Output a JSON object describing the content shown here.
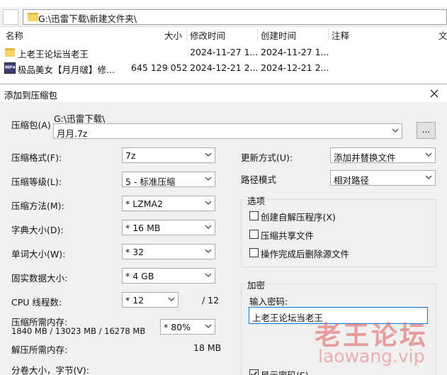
{
  "explorer": {
    "path": "G:\\迅雷下载\\新建文件夹\\",
    "columns": {
      "name": "名称",
      "size": "大小",
      "modified": "修改时间",
      "created": "创建时间",
      "comment": "注释",
      "overflow": "文"
    },
    "files": [
      {
        "name": "上老王论坛当老王",
        "size": "",
        "modified": "2024-11-27 1...",
        "created": "2024-11-27 1...",
        "icon": "folder-icon"
      },
      {
        "name": "极品美女【月月啵】修...",
        "size": "645 129 052",
        "modified": "2024-12-21 2...",
        "created": "2024-12-21 2...",
        "icon": "video-file-icon"
      }
    ]
  },
  "dialog": {
    "title": "添加到压缩包",
    "archive": {
      "label": "压缩包(A)",
      "folder": "G:\\迅雷下载\\",
      "value": "月月.7z",
      "browse": "..."
    },
    "format": {
      "label": "压缩格式(F):",
      "value": "7z"
    },
    "level": {
      "label": "压缩等级(L):",
      "value": "5 - 标准压缩"
    },
    "method": {
      "label": "压缩方法(M):",
      "value": "* LZMA2"
    },
    "dict": {
      "label": "字典大小(D):",
      "value": "* 16 MB"
    },
    "word": {
      "label": "单词大小(W):",
      "value": "* 32"
    },
    "solid": {
      "label": "固实数据大小:",
      "value": "* 4 GB"
    },
    "threads": {
      "label": "CPU 线程数:",
      "value": "* 12",
      "max": "/ 12"
    },
    "mem_compress": {
      "label": "压缩所需内存:",
      "detail": "1840 MB / 13023 MB / 16278 MB",
      "value": "* 80%"
    },
    "mem_decompress": {
      "label": "解压所需内存:",
      "value": "18 MB"
    },
    "split": {
      "label": "分卷大小，字节(V):"
    },
    "update": {
      "label": "更新方式(U):",
      "value": "添加并替换文件"
    },
    "path_mode": {
      "label": "路径模式",
      "value": "相对路径"
    },
    "options": {
      "title": "选项",
      "sfx": "创建自解压程序(X)",
      "shared": "压缩共享文件",
      "delete_after": "操作完成后删除源文件"
    },
    "encryption": {
      "title": "加密",
      "password_label": "输入密码:",
      "password_value": "上老王论坛当老王",
      "show_password": "显示密码(S)"
    }
  },
  "watermark": {
    "cn": "老王论坛",
    "url": "laowang.vip"
  },
  "colors": {
    "accent": "#0078d7",
    "folder": "#f7d46a",
    "watermark": "#e15a5a"
  }
}
